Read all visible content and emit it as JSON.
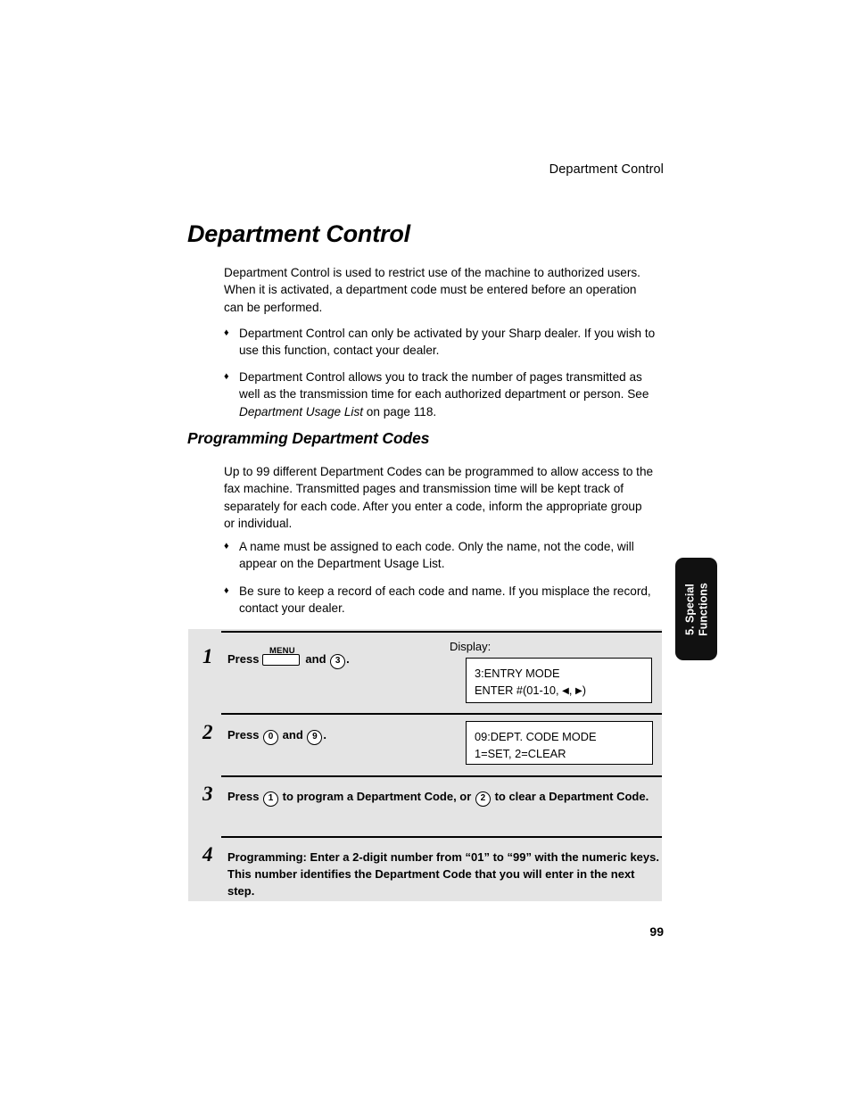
{
  "page": {
    "running_head": "Department Control",
    "folio": "99",
    "background": "#ffffff"
  },
  "headings": {
    "h1": "Department Control",
    "h2": "Programming Department Codes"
  },
  "intro_paragraph": "Department Control is used to restrict use of the machine to authorized users. When it is activated, a department code must be entered before an operation can be performed.",
  "intro_bullets": [
    {
      "marker": "♦",
      "text": "Department Control can only be activated by your Sharp dealer. If you wish to use this function, contact your dealer."
    },
    {
      "marker": "♦",
      "text_before": "Department Control allows you to track the number of pages transmitted as well as the transmission time for each authorized department or person. See ",
      "text_italic": "Department Usage List",
      "text_after": " on page 118."
    }
  ],
  "codes_paragraph": "Up to 99 different Department Codes can be programmed to allow access to the fax machine. Transmitted pages and transmission time will be kept track of separately for each code. After you enter a code, inform the appropriate group or individual.",
  "codes_bullets": [
    {
      "marker": "♦",
      "text": "A name must be assigned to each code. Only the name, not the code, will appear on the Department Usage List."
    },
    {
      "marker": "♦",
      "text": "Be sure to keep a record of each code and name. If you misplace the record, contact your dealer."
    }
  ],
  "steps": {
    "display_label": "Display:",
    "items": [
      {
        "number": "1",
        "press_label": "Press",
        "menu_key_label": "MENU",
        "and_label": "and",
        "key_digit": "3",
        "period": ".",
        "lcd_line1": "3:ENTRY MODE",
        "lcd_line2_before": "ENTER #(01-10, ",
        "lcd_arrow_left": "◀",
        "lcd_line2_mid": ", ",
        "lcd_arrow_right": "▶",
        "lcd_line2_after": ")"
      },
      {
        "number": "2",
        "press_label": "Press",
        "key_digit_1": "0",
        "and_label": "and",
        "key_digit_2": "9",
        "period": ".",
        "lcd_line1": "09:DEPT. CODE MODE",
        "lcd_line2": "1=SET, 2=CLEAR"
      },
      {
        "number": "3",
        "press_label": "Press",
        "key_digit_1": "1",
        "text_mid": "to program a Department Code, or",
        "key_digit_2": "2",
        "text_end": "to clear a Department Code."
      },
      {
        "number": "4",
        "text": "Programming: Enter a 2-digit number from “01” to “99” with the numeric keys. This number identifies the Department Code that you will enter in the next step."
      }
    ]
  },
  "side_tab": {
    "line1": "5. Special",
    "line2": "Functions",
    "background": "#111111",
    "color": "#ffffff"
  }
}
